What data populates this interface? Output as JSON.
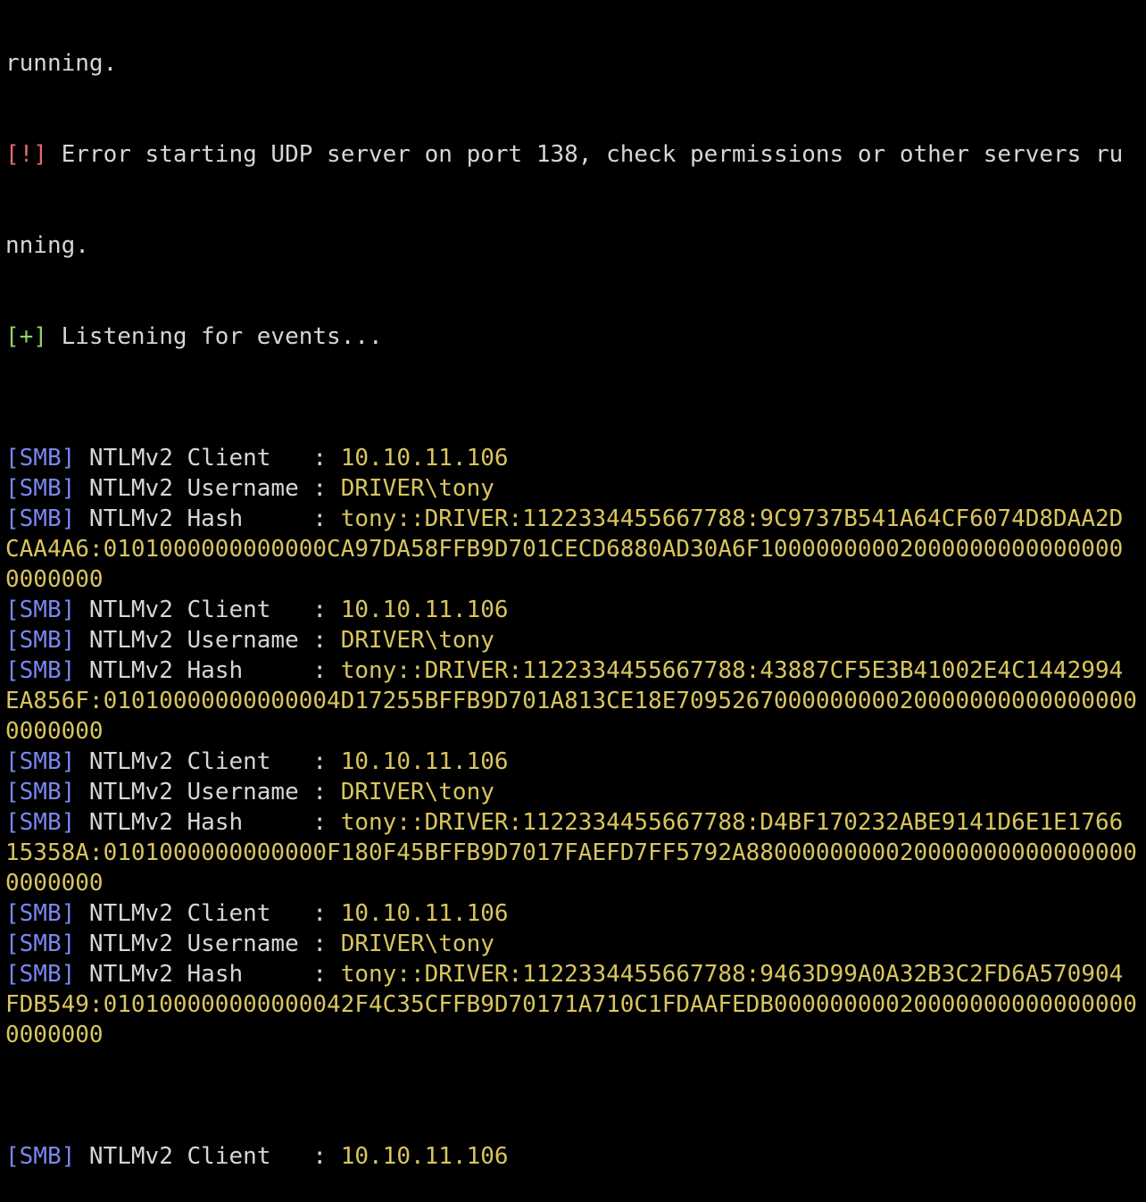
{
  "terminal": {
    "line0": "running.",
    "error_tag": "[!]",
    "error_text": " Error starting UDP server on port 138, check permissions or other servers ru",
    "error_cont": "nning.",
    "ok_tag": "[+]",
    "ok_text": " Listening for events...",
    "smb_tag": "[SMB]",
    "label_client": " NTLMv2 Client   ",
    "label_username": " NTLMv2 Username ",
    "label_hash": " NTLMv2 Hash     ",
    "separator": ": ",
    "client_ip": "10.10.11.106",
    "username": "DRIVER\\tony",
    "events": [
      {
        "hash_1": "tony::DRIVER:1122334455667788:9C9737B541A64CF6074D8DAA2D",
        "hash_2": "CAA4A6:0101000000000000CA97DA58FFB9D701CECD6880AD30A6F10000000002000000000000000",
        "hash_3": "0000000"
      },
      {
        "hash_1": "tony::DRIVER:1122334455667788:43887CF5E3B41002E4C1442994",
        "hash_2": "EA856F:01010000000000004D17255BFFB9D701A813CE18E709526700000000020000000000000000",
        "hash_3": "0000000"
      },
      {
        "hash_1": "tony::DRIVER:1122334455667788:D4BF170232ABE9141D6E1E1766",
        "hash_2": "15358A:0101000000000000F180F45BFFB9D7017FAEFD7FF5792A8800000000020000000000000000",
        "hash_3": "0000000"
      },
      {
        "hash_1": "tony::DRIVER:1122334455667788:9463D99A0A32B3C2FD6A570904",
        "hash_2": "FDB549:010100000000000042F4C35CFFB9D70171A710C1FDAAFEDB00000000020000000000000000",
        "hash_3": "0000000"
      }
    ],
    "partial_client_label": " NTLMv2 Client   ",
    "partial_client_ip": "10.10.11.106"
  }
}
